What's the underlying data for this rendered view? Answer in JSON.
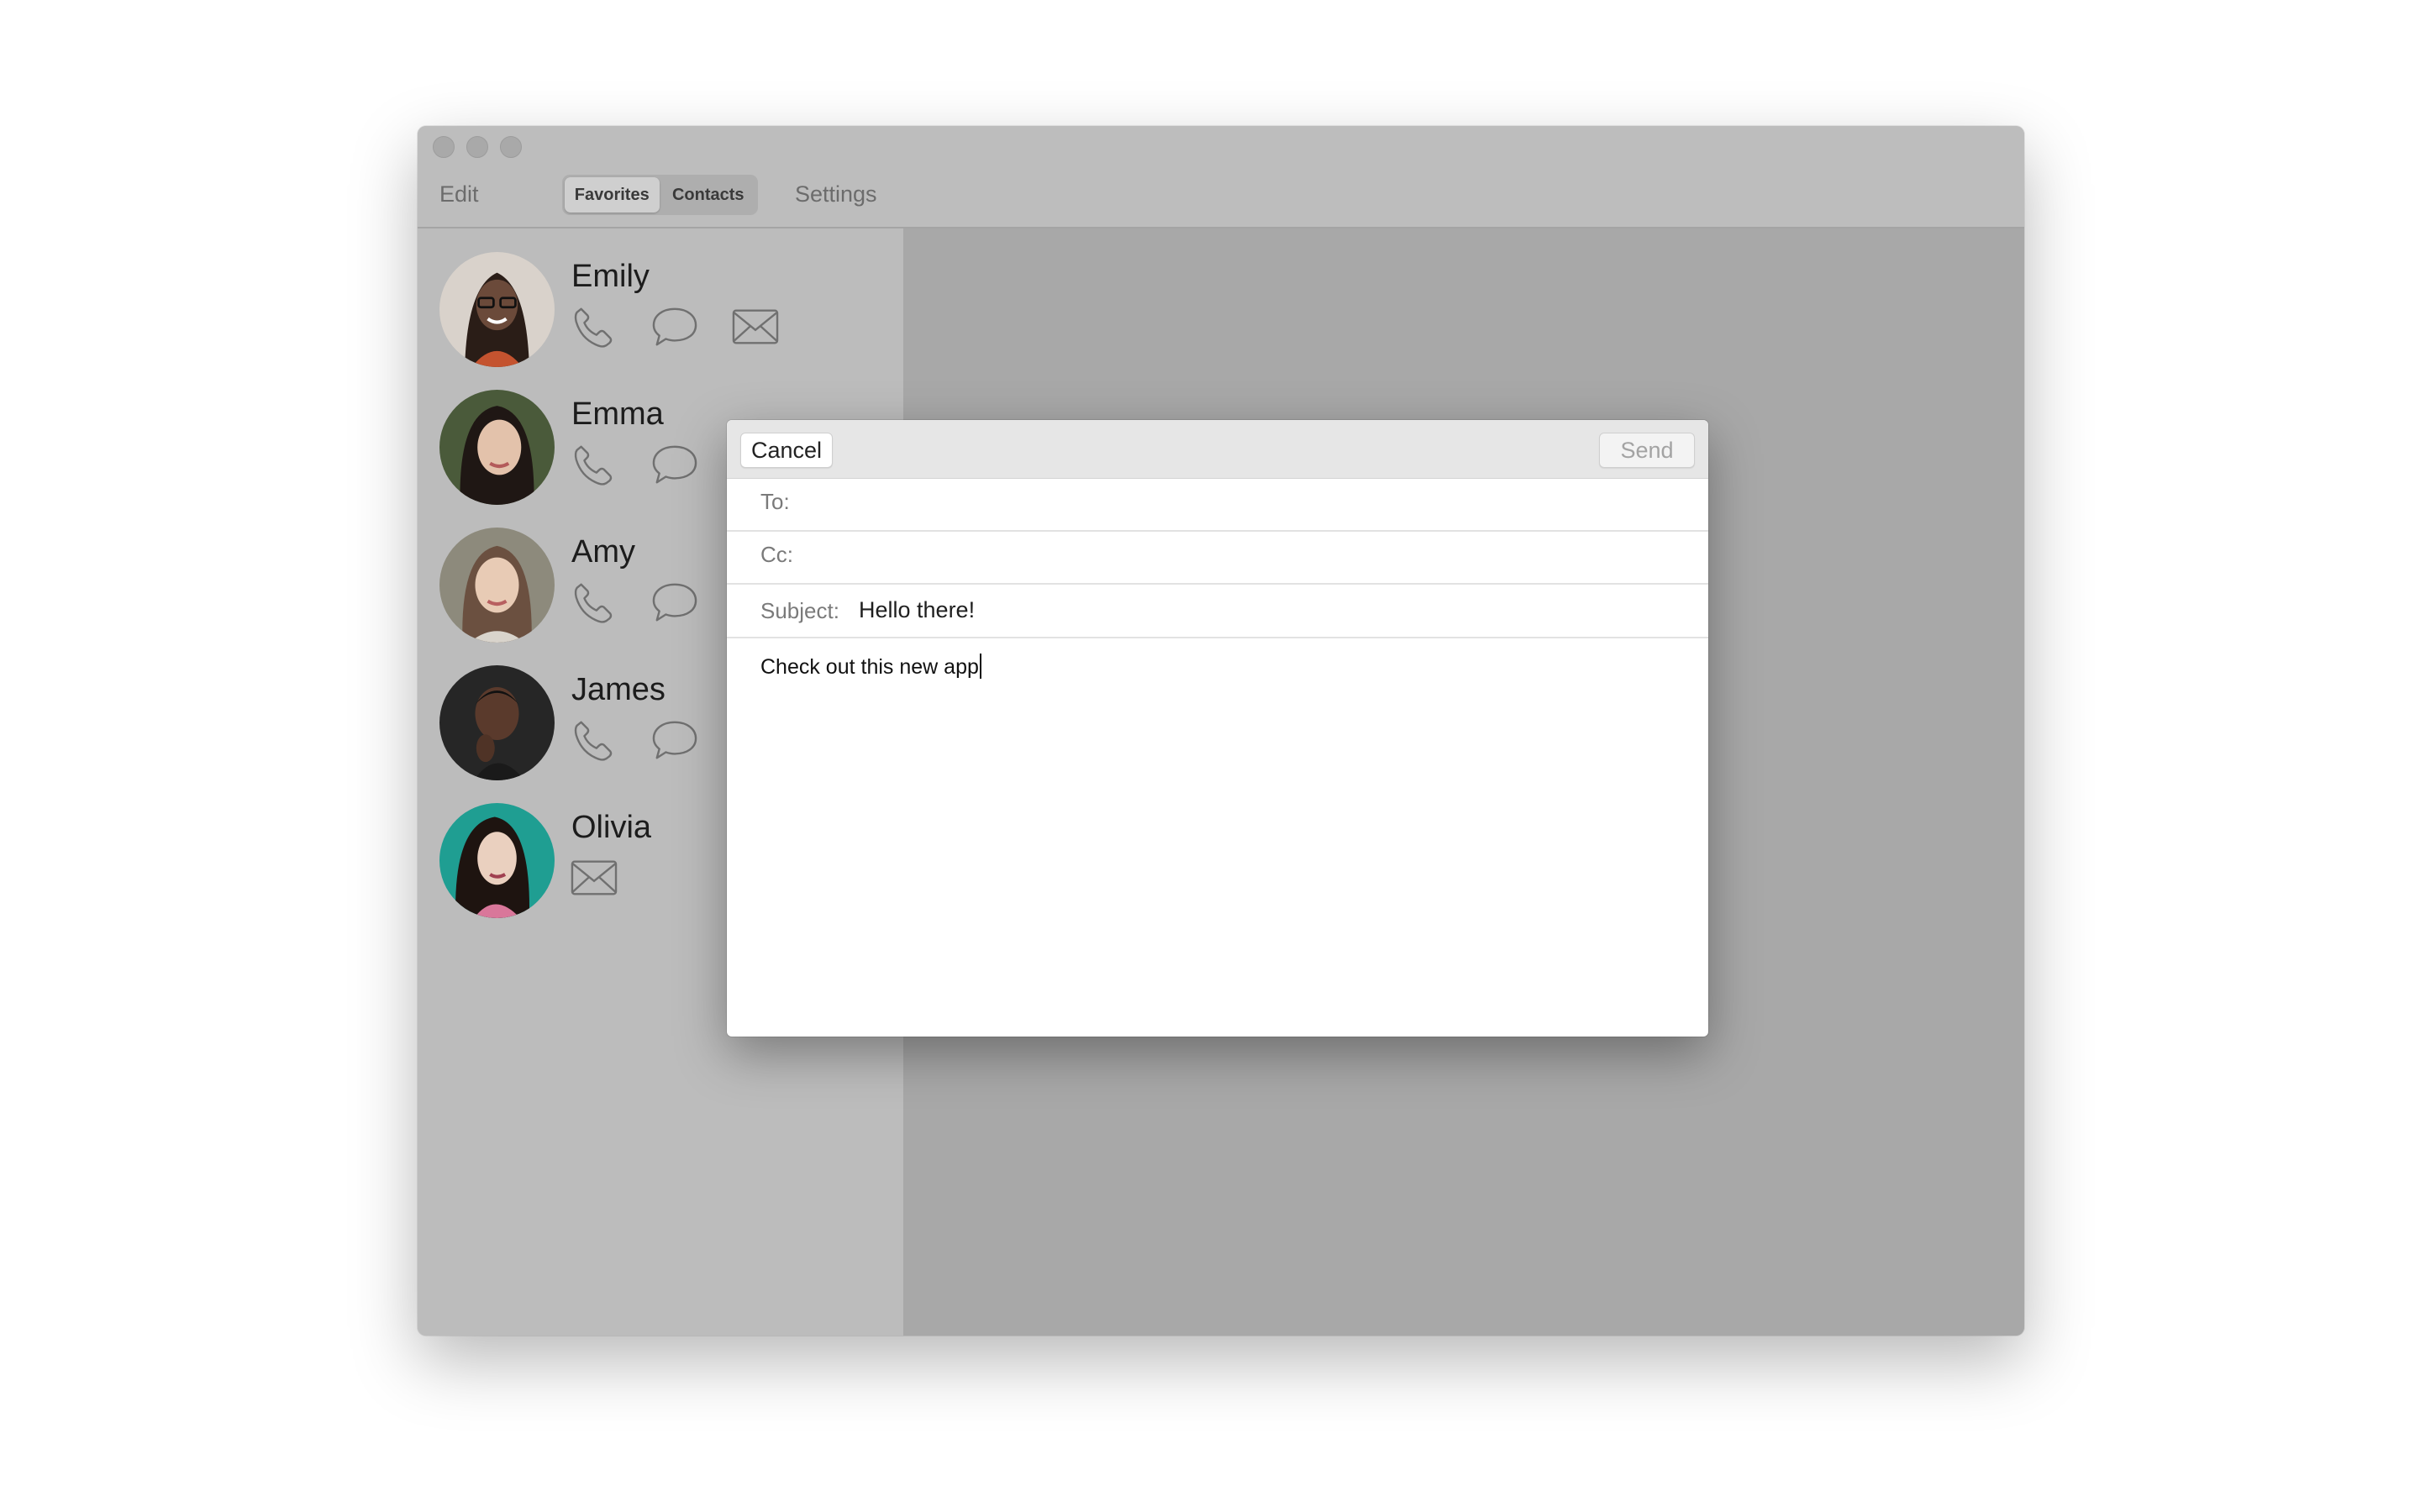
{
  "window": {
    "toolbar": {
      "edit_label": "Edit",
      "segments": [
        {
          "label": "Favorites",
          "selected": true
        },
        {
          "label": "Contacts",
          "selected": false
        }
      ],
      "settings_label": "Settings"
    }
  },
  "contacts": [
    {
      "name": "Emily",
      "actions": [
        "phone-icon",
        "message-icon",
        "mail-icon"
      ],
      "avatar_color": "#6b4a3a"
    },
    {
      "name": "Emma",
      "actions": [
        "phone-icon",
        "message-icon"
      ],
      "avatar_color": "#3b2e2a"
    },
    {
      "name": "Amy",
      "actions": [
        "phone-icon",
        "message-icon"
      ],
      "avatar_color": "#8a7a66"
    },
    {
      "name": "James",
      "actions": [
        "phone-icon",
        "message-icon"
      ],
      "avatar_color": "#2a211d"
    },
    {
      "name": "Olivia",
      "actions": [
        "mail-icon"
      ],
      "avatar_color": "#1f9e92"
    }
  ],
  "compose": {
    "cancel_label": "Cancel",
    "send_label": "Send",
    "to_label": "To:",
    "to_value": "",
    "cc_label": "Cc:",
    "cc_value": "",
    "subject_label": "Subject:",
    "subject_value": "Hello there!",
    "body": "Check out this new app"
  }
}
